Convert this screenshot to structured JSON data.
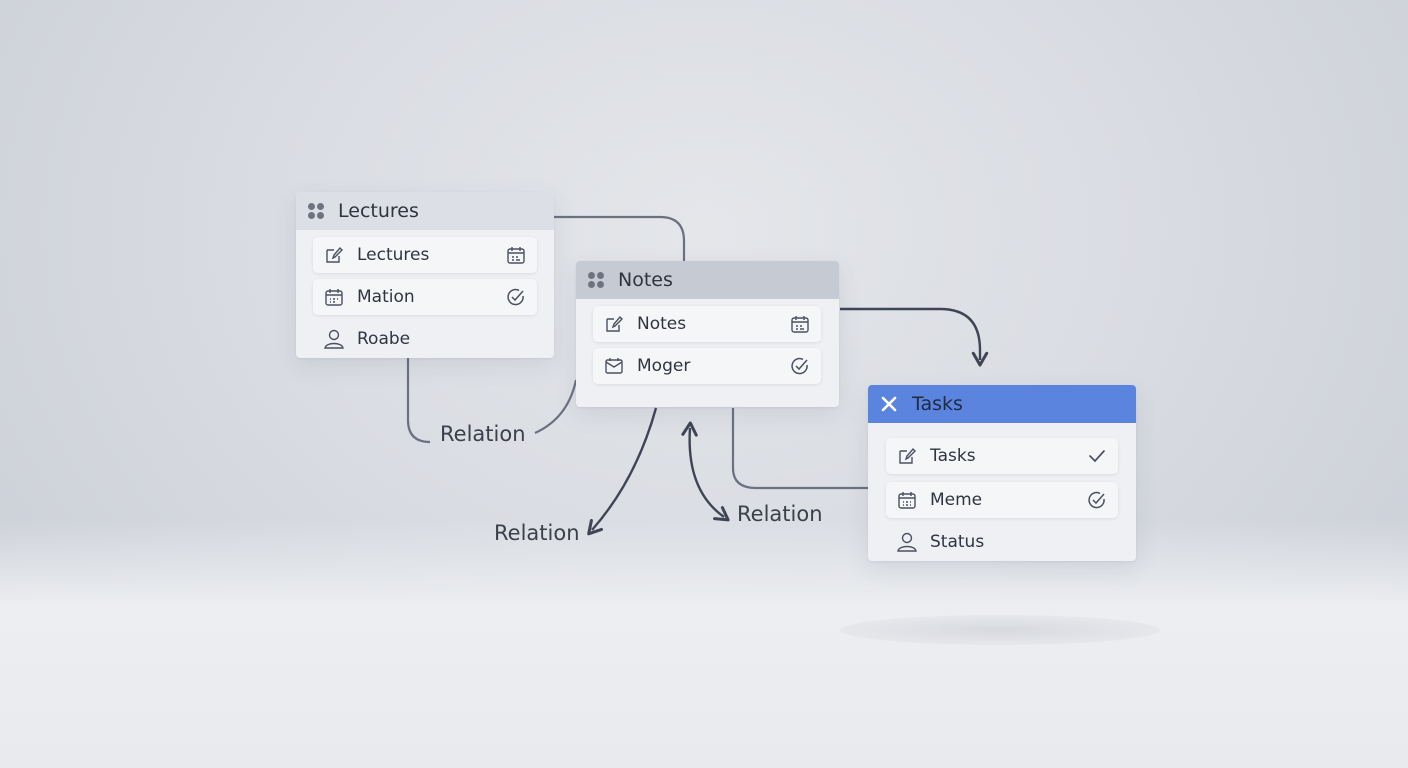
{
  "colors": {
    "accent": "#5b84de",
    "connector": "#3f4554"
  },
  "cards": {
    "lectures": {
      "title": "Lectures",
      "rows": [
        {
          "label": "Lectures",
          "icon": "edit-note-icon",
          "end_icon": "calendar-icon"
        },
        {
          "label": "Mation",
          "icon": "calendar-icon",
          "end_icon": "check-circle-icon"
        },
        {
          "label": "Roabe",
          "icon": "person-icon"
        }
      ]
    },
    "notes": {
      "title": "Notes",
      "rows": [
        {
          "label": "Notes",
          "icon": "edit-note-icon",
          "end_icon": "calendar-icon"
        },
        {
          "label": "Moger",
          "icon": "envelope-icon",
          "end_icon": "check-circle-icon"
        }
      ]
    },
    "tasks": {
      "title": "Tasks",
      "header_icon": "close-icon",
      "rows": [
        {
          "label": "Tasks",
          "icon": "edit-note-icon",
          "end_icon": "check-icon"
        },
        {
          "label": "Meme",
          "icon": "calendar-icon",
          "end_icon": "check-circle-icon"
        },
        {
          "label": "Status",
          "icon": "person-icon"
        }
      ]
    }
  },
  "relations": [
    "Relation",
    "Relation",
    "Relation"
  ]
}
